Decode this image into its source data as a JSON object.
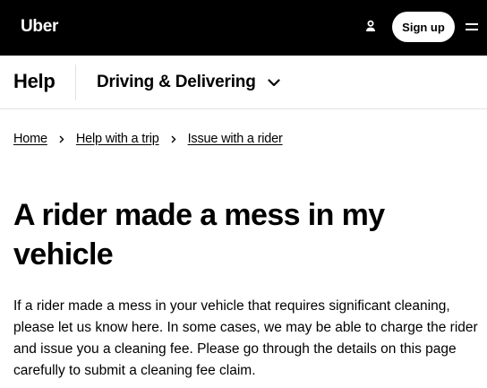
{
  "header": {
    "logo_text": "Uber",
    "signup_label": "Sign up",
    "user_icon": "person-icon",
    "menu_icon": "hamburger-menu-icon"
  },
  "subnav": {
    "title": "Help",
    "section": "Driving & Delivering",
    "chevron_icon": "chevron-down-icon"
  },
  "breadcrumb": {
    "items": [
      "Home",
      "Help with a trip",
      "Issue with a rider"
    ],
    "separator_icon": "chevron-right-icon"
  },
  "article": {
    "title": "A rider made a mess in my vehicle",
    "intro": "If a rider made a mess in your vehicle that requires significant cleaning, please let us know here. In some cases, we may be able to charge the rider and issue you a cleaning fee. Please go through the details on this page carefully to submit a cleaning fee claim."
  },
  "colors": {
    "topbar_bg": "#000000",
    "text": "#000000",
    "divider": "#e2e2e2",
    "button_bg": "#ffffff"
  }
}
